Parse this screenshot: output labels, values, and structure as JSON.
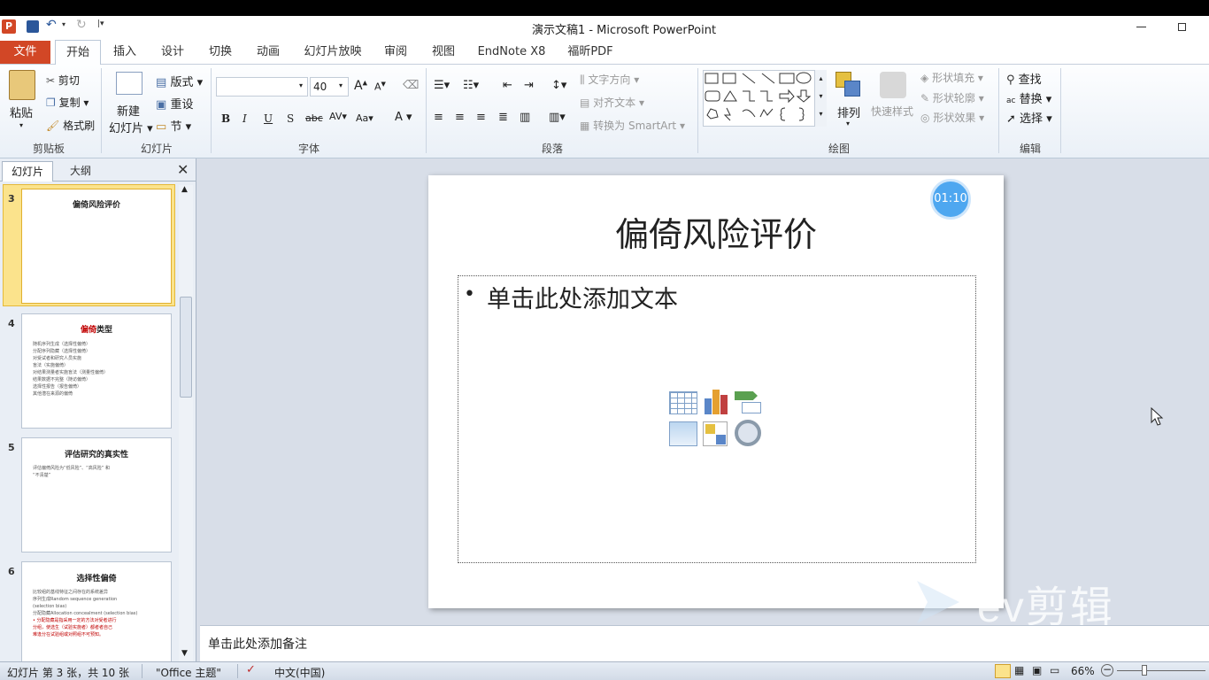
{
  "window": {
    "title": "演示文稿1 - Microsoft PowerPoint"
  },
  "ribbon_tabs": [
    {
      "label": "文件"
    },
    {
      "label": "开始"
    },
    {
      "label": "插入"
    },
    {
      "label": "设计"
    },
    {
      "label": "切换"
    },
    {
      "label": "动画"
    },
    {
      "label": "幻灯片放映"
    },
    {
      "label": "审阅"
    },
    {
      "label": "视图"
    },
    {
      "label": "EndNote X8"
    },
    {
      "label": "福昕PDF"
    }
  ],
  "ribbon": {
    "clipboard": {
      "paste": "粘贴",
      "cut": "剪切",
      "copy": "复制",
      "format_painter": "格式刷",
      "label": "剪贴板"
    },
    "slides": {
      "new_slide_line1": "新建",
      "new_slide_line2": "幻灯片",
      "layout": "版式",
      "reset": "重设",
      "section": "节",
      "label": "幻灯片"
    },
    "font": {
      "size": "40",
      "label": "字体"
    },
    "paragraph": {
      "text_direction": "文字方向",
      "align_text": "对齐文本",
      "convert_smartart": "转换为 SmartArt",
      "label": "段落"
    },
    "drawing": {
      "arrange": "排列",
      "quick_styles": "快速样式",
      "shape_fill": "形状填充",
      "shape_outline": "形状轮廓",
      "shape_effects": "形状效果",
      "label": "绘图"
    },
    "editing": {
      "find": "查找",
      "replace": "替换",
      "select": "选择",
      "label": "编辑"
    }
  },
  "panel": {
    "tabs": [
      "幻灯片",
      "大纲"
    ]
  },
  "thumbnails": [
    {
      "num": "3",
      "title": "偏倚风险评价",
      "lines": []
    },
    {
      "num": "4",
      "title_red": "偏倚",
      "title_rest": "类型",
      "lines": [
        "随机序列生成（选择性偏倚）",
        "分配序列隐藏（选择性偏倚）",
        "对受试者和研究人员实施",
        "盲法（实施偏倚）",
        "对结果测量者实施盲法（测量性偏倚）",
        "结果数据不完整（随访偏倚）",
        "选择性报告（报告偏倚）",
        "其他潜在来源的偏倚"
      ]
    },
    {
      "num": "5",
      "title": "评估研究的真实性",
      "lines": [
        "评估偏倚风险为“低风险”、“高风险” 和",
        "“不清楚”"
      ]
    },
    {
      "num": "6",
      "title": "选择性偏倚",
      "lines": [
        "比较组的基线特征之间存在的系统差异",
        "",
        "序列生成Random sequence generation",
        "(selection bias)",
        "分配隐藏Allocation concealment (selection bias)"
      ],
      "red_lines": [
        "• 分配隐藏是指采用一定的方法对受者进行",
        "  分组，使选生（试验实施者）都者者自己",
        "  难逢分在试验组或对照组不可预知。"
      ]
    }
  ],
  "slide": {
    "title": "偏倚风险评价",
    "bullet": "单击此处添加文本",
    "timer": "01:10"
  },
  "notes": {
    "placeholder": "单击此处添加备注"
  },
  "status": {
    "slide_info": "幻灯片 第 3 张，共 10 张",
    "theme": "\"Office 主题\"",
    "language": "中文(中国)",
    "zoom": "66%"
  },
  "watermark": {
    "text": "ev剪辑"
  }
}
